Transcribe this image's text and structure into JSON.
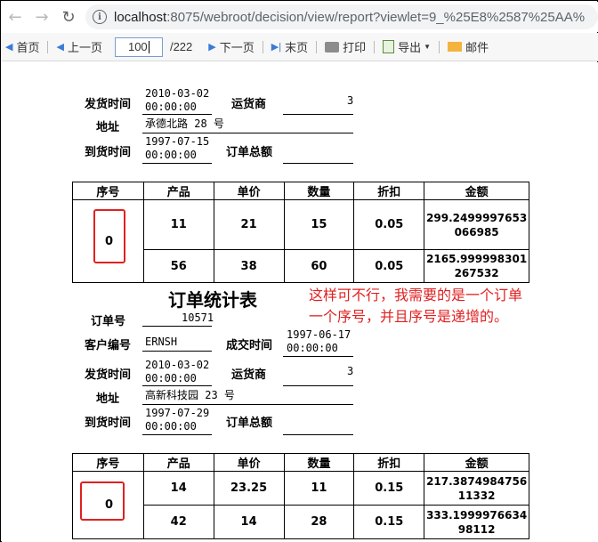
{
  "browser": {
    "back_icon": "arrow-left-icon",
    "forward_icon": "arrow-right-icon",
    "reload_icon": "reload-icon",
    "info_glyph": "i",
    "url_host": "localhost",
    "url_rest": ":8075/webroot/decision/view/report?viewlet=9_%25E8%2587%25AA%"
  },
  "toolbar": {
    "first": "首页",
    "prev": "上一页",
    "page_value": "100",
    "total": "/222",
    "next": "下一页",
    "last": "末页",
    "print": "打印",
    "export": "导出",
    "mail": "邮件"
  },
  "block1": {
    "ship_time_label": "发货时间",
    "ship_time_value": [
      "2010-03-02",
      "00:00:00"
    ],
    "carrier_label": "运货商",
    "carrier_value": "3",
    "address_label": "地址",
    "address_value": "承德北路 28 号",
    "arrival_label": "到货时间",
    "arrival_value": [
      "1997-07-15",
      "00:00:00"
    ],
    "total_label": "订单总额",
    "total_value": ""
  },
  "table1": {
    "headers": [
      "序号",
      "产品",
      "单价",
      "数量",
      "折扣",
      "金额"
    ],
    "seq": "0",
    "rows": [
      {
        "product": "11",
        "price": "21",
        "qty": "15",
        "discount": "0.05",
        "amount": "299.2499997653066985"
      },
      {
        "product": "56",
        "price": "38",
        "qty": "60",
        "discount": "0.05",
        "amount": "2165.999998301267532"
      }
    ]
  },
  "report_title": "订单统计表",
  "annotation": [
    "这样可不行，我需要的是一个订单",
    "一个序号，并且序号是递增的。"
  ],
  "block2": {
    "order_no_label": "订单号",
    "order_no_value": "10571",
    "customer_label": "客户编号",
    "customer_value": "ERNSH",
    "deal_time_label": "成交时间",
    "deal_time_value": [
      "1997-06-17",
      "00:00:00"
    ],
    "ship_time_label": "发货时间",
    "ship_time_value": [
      "2010-03-02",
      "00:00:00"
    ],
    "carrier_label": "运货商",
    "carrier_value": "3",
    "address_label": "地址",
    "address_value": "高新科技园 23 号",
    "arrival_label": "到货时间",
    "arrival_value": [
      "1997-07-29",
      "00:00:00"
    ],
    "total_label": "订单总额",
    "total_value": ""
  },
  "table2": {
    "headers": [
      "序号",
      "产品",
      "单价",
      "数量",
      "折扣",
      "金额"
    ],
    "seq": "0",
    "rows": [
      {
        "product": "14",
        "price": "23.25",
        "qty": "11",
        "discount": "0.15",
        "amount": "217.387498475611332"
      },
      {
        "product": "42",
        "price": "14",
        "qty": "28",
        "discount": "0.15",
        "amount": "333.199997663498112"
      }
    ]
  },
  "colors": {
    "annotation_red": "#e02020",
    "toolbar_bg": "#f7f7f7",
    "omnibox_bg": "#f1f3f4"
  }
}
